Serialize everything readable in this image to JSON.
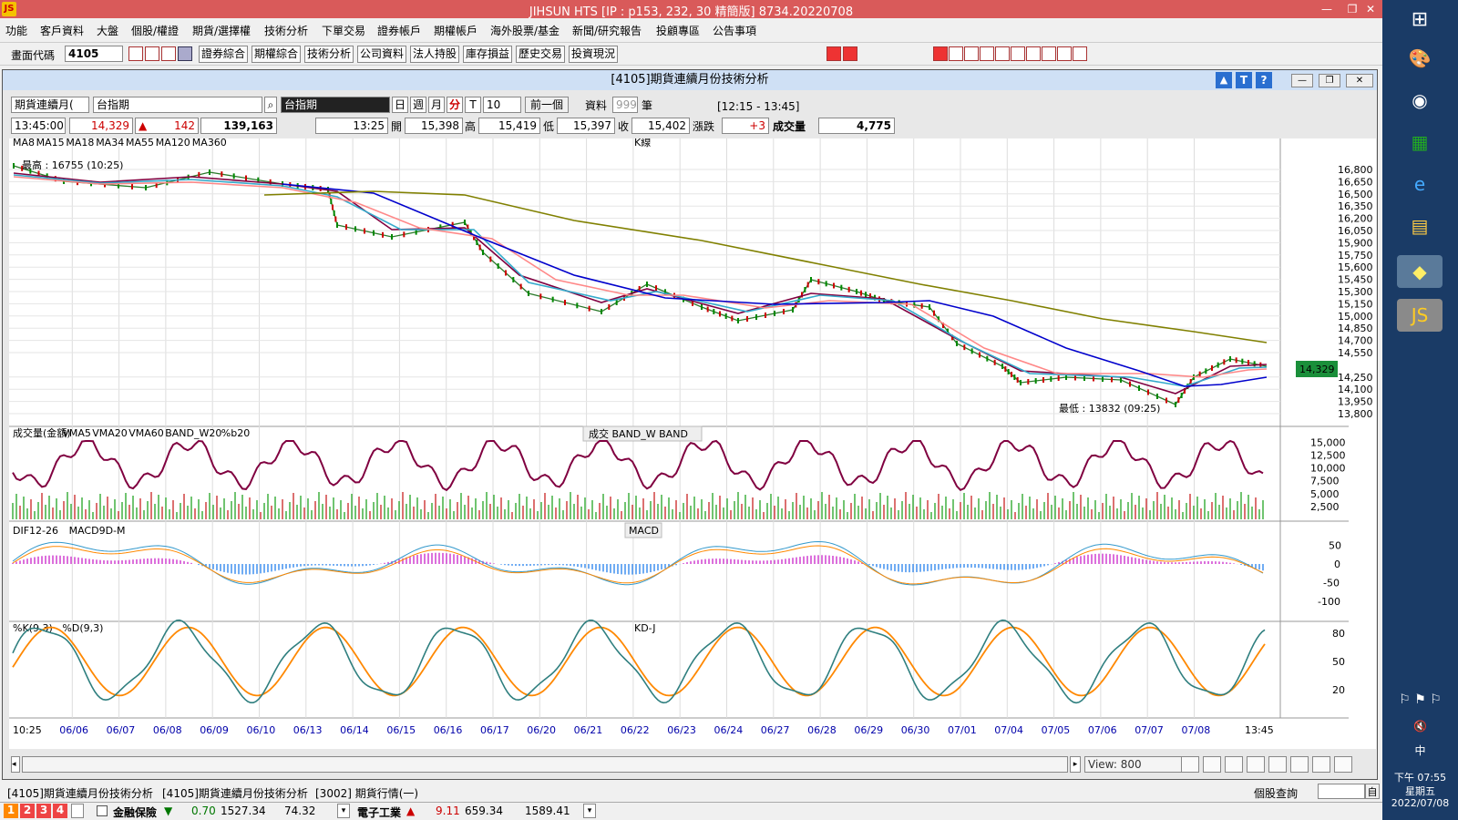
{
  "window": {
    "title": "JIHSUN HTS     [IP : p153, 232, 30 精簡版] 8734.20220708",
    "logo": "jihsun-logo",
    "controls": [
      "—",
      "❐",
      "✕"
    ]
  },
  "menu": [
    "功能",
    "客戶資料",
    "大盤",
    "個股/權證",
    "期貨/選擇權",
    "技術分析",
    "下單交易",
    "證券帳戶",
    "期權帳戶",
    "海外股票/基金",
    "新聞/研究報告",
    "投顧專區",
    "公告事項"
  ],
  "toolbar": {
    "code_label": "畫面代碼",
    "code_value": "4105",
    "buttons": [
      "證券綜合",
      "期權綜合",
      "技術分析",
      "公司資料",
      "法人持股",
      "庫存損益",
      "歷史交易",
      "投資現況"
    ]
  },
  "child": {
    "title": "[4105]期貨連續月份技術分析",
    "controls": [
      "▲",
      "T",
      "?"
    ],
    "wincontrols": [
      "—",
      "❐",
      "✕"
    ]
  },
  "selector": {
    "type": "期貨連續月(",
    "market": "台指期",
    "name_display": "台指期",
    "periods": [
      "日",
      "週",
      "月",
      "分",
      "T"
    ],
    "interval": "10",
    "prev": "前一個",
    "data_label": "資料",
    "data_count": "999",
    "data_unit": "筆",
    "range": "[12:15 - 13:45]"
  },
  "quote": {
    "time": "13:45:00",
    "price": "14,329",
    "change": "142",
    "volume": "139,163",
    "bar_time": "13:25",
    "open_label": "開",
    "open": "15,398",
    "high_label": "高",
    "high": "15,419",
    "low_label": "低",
    "low": "15,397",
    "close_label": "收",
    "close": "15,402",
    "chg_label": "漲跌",
    "chg": "+3",
    "vol_label": "成交量",
    "vol": "4,775"
  },
  "panels": {
    "kline": {
      "label": "K線",
      "legend": [
        {
          "name": "MA8",
          "color": "#800040"
        },
        {
          "name": "MA15",
          "color": "#cc44cc"
        },
        {
          "name": "MA18",
          "color": "#800000"
        },
        {
          "name": "MA34",
          "color": "#33aacc"
        },
        {
          "name": "MA55",
          "color": "#ff8888"
        },
        {
          "name": "MA120",
          "color": "#0000cc"
        },
        {
          "name": "MA360",
          "color": "#808000"
        }
      ],
      "high_note": "最高 : 16755 (10:25)",
      "low_note": "最低 : 13832 (09:25)",
      "last_price": "14,329",
      "yticks": [
        "16,800",
        "16,650",
        "16,500",
        "16,350",
        "16,200",
        "16,050",
        "15,900",
        "15,750",
        "15,600",
        "15,450",
        "15,300",
        "15,150",
        "15,000",
        "14,850",
        "14,700",
        "14,550",
        "14,250",
        "14,100",
        "13,950",
        "13,800"
      ]
    },
    "volume": {
      "label": "成交  BAND_W  BAND",
      "legend": [
        {
          "name": "成交量(金額)",
          "color": "#000"
        },
        {
          "name": "VMA5",
          "color": "#3399cc"
        },
        {
          "name": "VMA20",
          "color": "#cc0000"
        },
        {
          "name": "VMA60",
          "color": "#806000"
        },
        {
          "name": "BAND_W20",
          "color": "#808000"
        },
        {
          "name": "%b20",
          "color": "#800040"
        }
      ],
      "yticks": [
        "15,000",
        "12,500",
        "10,000",
        "7,500",
        "5,000",
        "2,500"
      ]
    },
    "macd": {
      "label": "MACD",
      "legend": [
        {
          "name": "DIF12-26",
          "color": "#3399cc"
        },
        {
          "name": "MACD9",
          "color": "#ff8800"
        },
        {
          "name": "D-M",
          "color": "#cc00cc"
        }
      ],
      "yticks": [
        "50",
        "0",
        "-50",
        "-100"
      ]
    },
    "kd": {
      "label": "KD-J",
      "legend": [
        {
          "name": "%K(9,3)",
          "color": "#2f7f7f"
        },
        {
          "name": "%D(9,3)",
          "color": "#ff8800"
        }
      ],
      "yticks": [
        "80",
        "50",
        "20"
      ]
    }
  },
  "xaxis": [
    "10:25",
    "06/06",
    "06/07",
    "06/08",
    "06/09",
    "06/10",
    "06/13",
    "06/14",
    "06/15",
    "06/16",
    "06/17",
    "06/20",
    "06/21",
    "06/22",
    "06/23",
    "06/24",
    "06/27",
    "06/28",
    "06/29",
    "06/30",
    "07/01",
    "07/04",
    "07/05",
    "07/06",
    "07/07",
    "07/08",
    "13:45"
  ],
  "view": {
    "label": "View:",
    "value": "800"
  },
  "tabs": [
    "[4105]期貨連續月份技術分析",
    "[4105]期貨連續月份技術分析",
    "[3002] 期貨行情(一)"
  ],
  "status": {
    "nums": [
      "1",
      "2",
      "3",
      "4"
    ],
    "sector1": "金融保險",
    "s1_chg": "0.70",
    "s1_val": "1527.34",
    "s1_vol": "74.32",
    "sector2": "電子工業",
    "s2_chg": "9.11",
    "s2_val": "659.34",
    "s2_vol": "1589.41",
    "query": "個股查詢",
    "query_btn": "自"
  },
  "clock": {
    "time": "下午 07:55",
    "day": "星期五",
    "date": "2022/07/08",
    "ime": "中"
  }
}
